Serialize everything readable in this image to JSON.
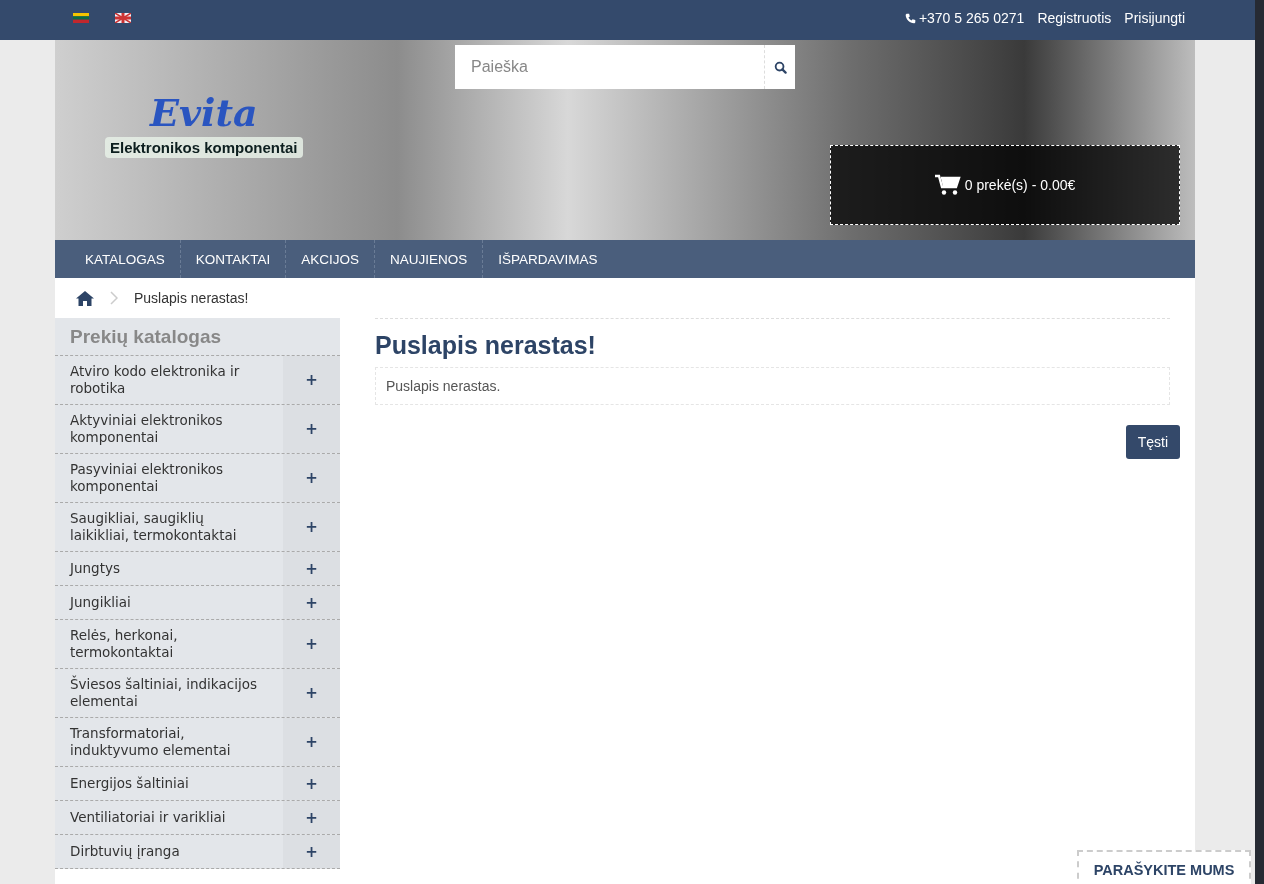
{
  "top_bar": {
    "languages": [
      {
        "kind": "lt"
      },
      {
        "kind": "en"
      }
    ],
    "phone": "+370 5 265 0271",
    "links": [
      "Registruotis",
      "Prisijungti"
    ]
  },
  "header": {
    "logo": "Evita",
    "tagline": "Elektronikos komponentai",
    "search": {
      "placeholder": "Paieška"
    },
    "cart": "0 prekė(s) - 0.00€"
  },
  "nav": [
    "KATALOGAS",
    "KONTAKTAI",
    "AKCIJOS",
    "NAUJIENOS",
    "IŠPARDAVIMAS"
  ],
  "breadcrumb": "Puslapis nerastas!",
  "sidebar": {
    "title": "Prekių katalogas",
    "items": [
      {
        "label": "Atviro kodo elektronika ir robotika",
        "toggle": "+"
      },
      {
        "label": "Aktyviniai elektronikos komponentai",
        "toggle": "+"
      },
      {
        "label": "Pasyviniai elektronikos komponentai",
        "toggle": "+"
      },
      {
        "label": "Saugikliai, saugiklių laikikliai, termokontaktai",
        "toggle": "+"
      },
      {
        "label": "Jungtys",
        "toggle": "+"
      },
      {
        "label": "Jungikliai",
        "toggle": "+"
      },
      {
        "label": "Relės, herkonai, termokontaktai",
        "toggle": "+"
      },
      {
        "label": "Šviesos šaltiniai, indikacijos elementai",
        "toggle": "+"
      },
      {
        "label": "Transformatoriai, induktyvumo elementai",
        "toggle": "+"
      },
      {
        "label": "Energijos šaltiniai",
        "toggle": "+"
      },
      {
        "label": "Ventiliatoriai ir varikliai",
        "toggle": "+"
      },
      {
        "label": "Dirbtuvių įranga",
        "toggle": "+"
      }
    ]
  },
  "content": {
    "title": "Puslapis nerastas!",
    "message": "Puslapis nerastas.",
    "button": "Tęsti"
  },
  "contact_widget": "PARAŠYKITE MUMS"
}
